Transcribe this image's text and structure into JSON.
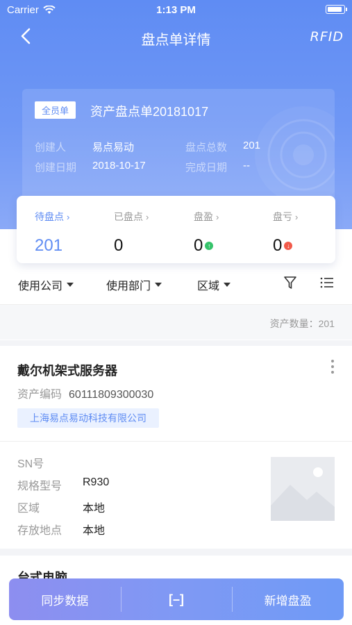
{
  "status": {
    "carrier": "Carrier",
    "time": "1:13 PM"
  },
  "nav": {
    "title": "盘点单详情",
    "rfid_label": "RFID"
  },
  "info": {
    "badge": "全员单",
    "doc_title": "资产盘点单20181017",
    "creator_label": "创建人",
    "creator_value": "易点易动",
    "total_label": "盘点总数",
    "total_value": "201",
    "created_date_label": "创建日期",
    "created_date_value": "2018-10-17",
    "finish_date_label": "完成日期",
    "finish_date_value": "--"
  },
  "stats": [
    {
      "label": "待盘点",
      "value": "201"
    },
    {
      "label": "已盘点",
      "value": "0"
    },
    {
      "label": "盘盈",
      "value": "0",
      "indicator_color": "#36c36b"
    },
    {
      "label": "盘亏",
      "value": "0",
      "indicator_color": "#f25a4a"
    }
  ],
  "filters": {
    "company": "使用公司",
    "department": "使用部门",
    "area": "区域"
  },
  "asset_count": "资产数量：201",
  "asset": {
    "name": "戴尔机架式服务器",
    "code_label": "资产编码",
    "code_value": "60111809300030",
    "company": "上海易点易动科技有限公司",
    "sn_label": "SN号",
    "sn_value": "",
    "model_label": "规格型号",
    "model_value": "R930",
    "area_label": "区域",
    "area_value": "本地",
    "location_label": "存放地点",
    "location_value": "本地"
  },
  "next_asset": {
    "name": "台式电脑"
  },
  "bottom": {
    "sync": "同步数据",
    "scan": "[–]",
    "add_surplus": "新增盘盈"
  },
  "colors": {
    "accent": "#5f8cf3",
    "surplus": "#36c36b",
    "loss": "#f25a4a"
  }
}
